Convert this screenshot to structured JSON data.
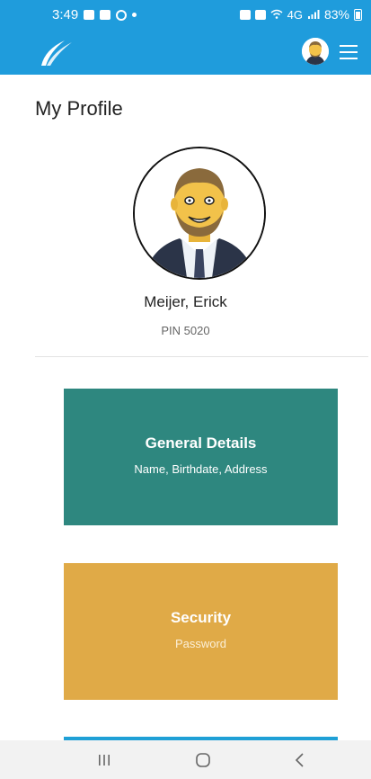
{
  "status_bar": {
    "time": "3:49",
    "network_label": "4G",
    "battery": "83%"
  },
  "profile": {
    "page_title": "My Profile",
    "name": "Meijer, Erick",
    "pin": "PIN 5020"
  },
  "cards": [
    {
      "title": "General Details",
      "subtitle": "Name, Birthdate, Address",
      "color": "#2e877f"
    },
    {
      "title": "Security",
      "subtitle": "Password",
      "color": "#e0aa47"
    },
    {
      "color": "#1fa0d6"
    }
  ],
  "colors": {
    "app_bar": "#1f9cdc",
    "nav_bar": "#f2f2f2"
  },
  "icons": {
    "logo": "swoosh-logo",
    "menu": "hamburger-menu-icon",
    "nav_recent": "recent-apps-icon",
    "nav_home": "home-icon",
    "nav_back": "back-icon"
  }
}
